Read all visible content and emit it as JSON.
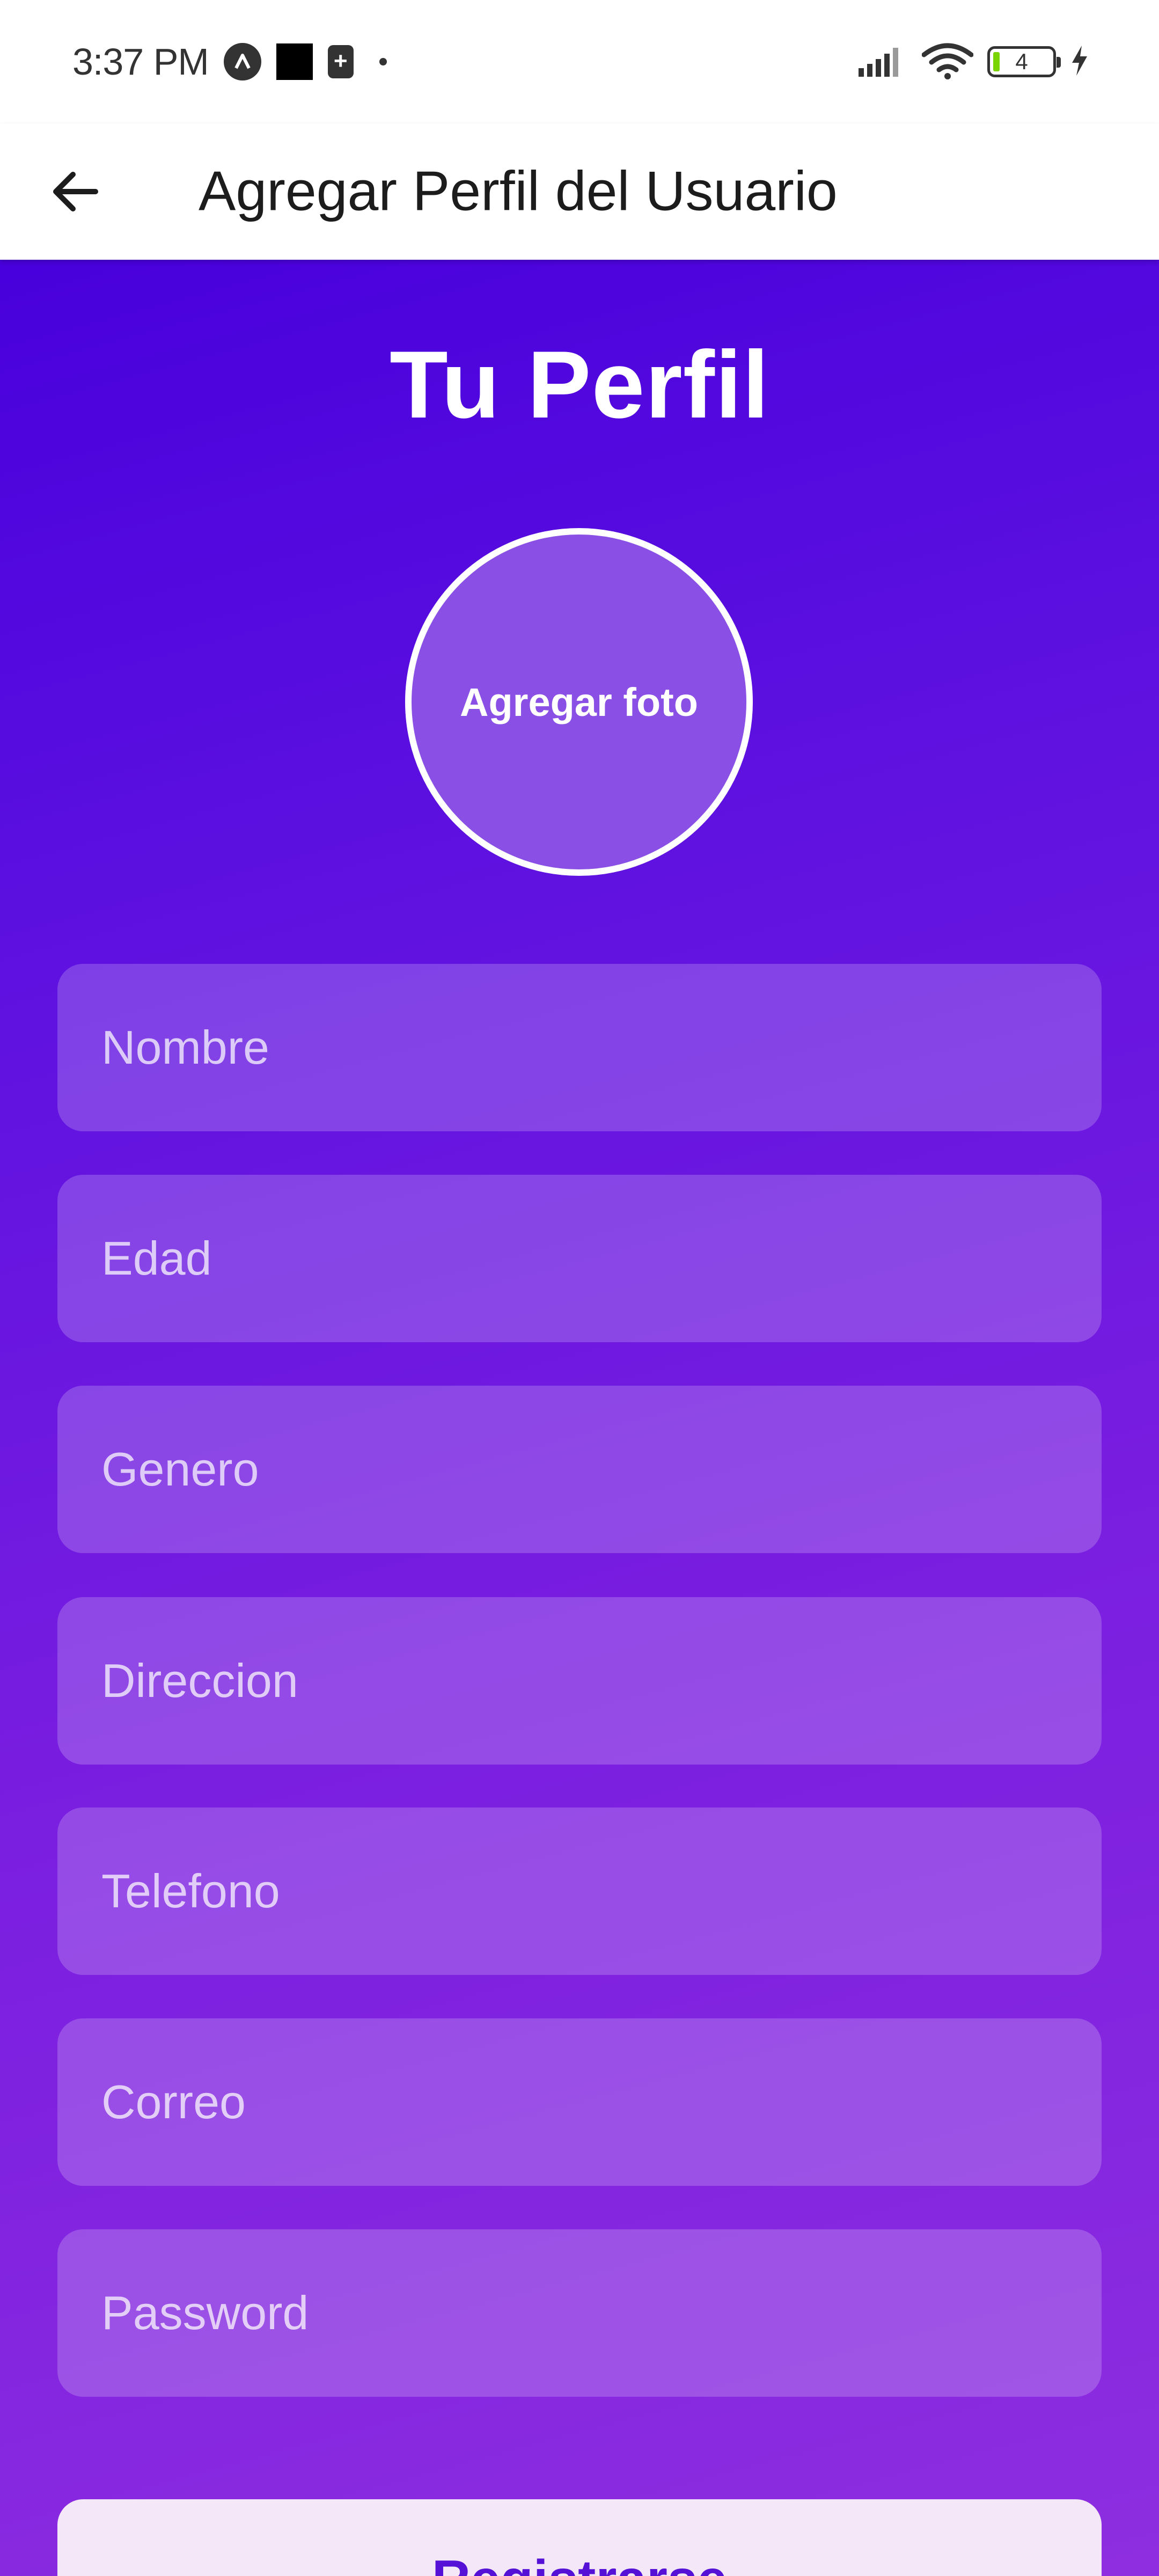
{
  "status_bar": {
    "time": "3:37 PM",
    "battery_level": "4",
    "icons": [
      "notification-a-icon",
      "black-square-icon",
      "battery-saver-icon",
      "dot-icon",
      "signal-icon",
      "wifi-icon",
      "battery-icon",
      "charging-bolt-icon"
    ]
  },
  "app_bar": {
    "title": "Agregar Perfil del Usuario",
    "back_icon": "arrow-left-icon"
  },
  "main": {
    "title": "Tu Perfil",
    "photo_label": "Agregar foto",
    "fields": {
      "nombre": {
        "placeholder": "Nombre",
        "value": ""
      },
      "edad": {
        "placeholder": "Edad",
        "value": ""
      },
      "genero": {
        "placeholder": "Genero",
        "value": ""
      },
      "direccion": {
        "placeholder": "Direccion",
        "value": ""
      },
      "telefono": {
        "placeholder": "Telefono",
        "value": ""
      },
      "correo": {
        "placeholder": "Correo",
        "value": ""
      },
      "password": {
        "placeholder": "Password",
        "value": ""
      }
    },
    "submit_label": "Registrarse"
  },
  "colors": {
    "gradient_top": "#4800dc",
    "gradient_bottom": "#8e2ee0",
    "button_bg": "#f3e7f8",
    "button_text": "#5512d6"
  }
}
